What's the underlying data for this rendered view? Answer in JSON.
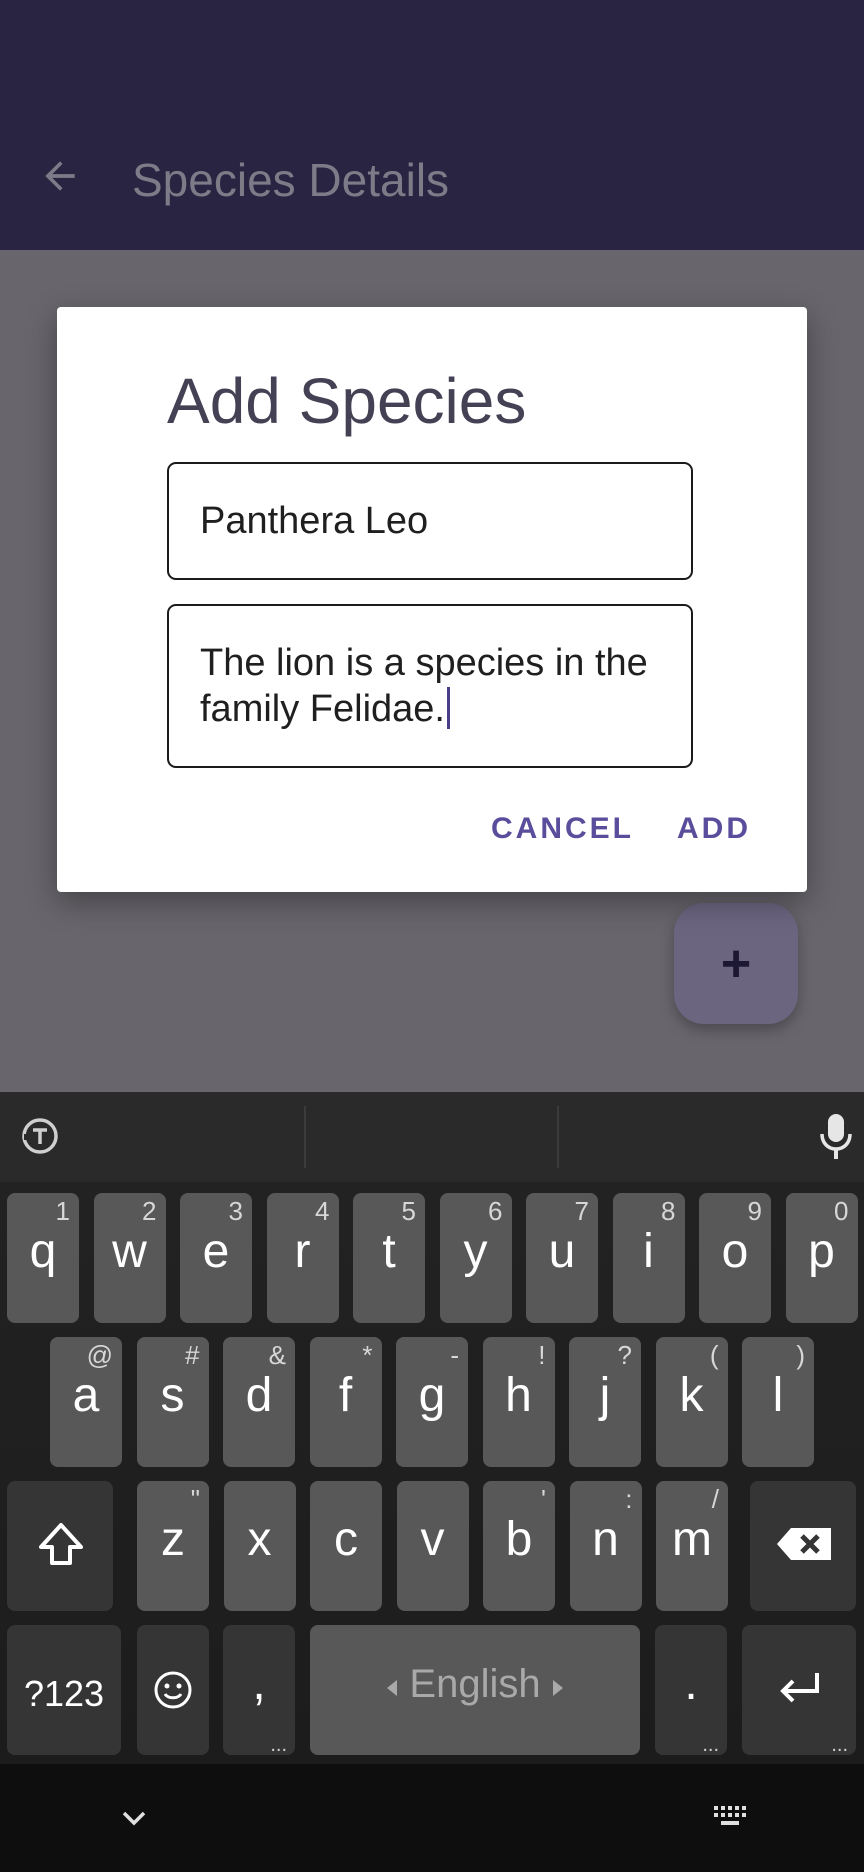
{
  "app_bar": {
    "title": "Species Details",
    "back_icon": "arrow-left-icon"
  },
  "fab": {
    "label": "+",
    "icon": "add-icon"
  },
  "dialog": {
    "title": "Add Species",
    "name_value": "Panthera Leo",
    "description_value": "The lion is a species in the family Felidae.",
    "cancel_label": "CANCEL",
    "add_label": "ADD",
    "accent_color": "#5a4d9c"
  },
  "keyboard": {
    "row1": [
      {
        "key": "q",
        "hint": "1"
      },
      {
        "key": "w",
        "hint": "2"
      },
      {
        "key": "e",
        "hint": "3"
      },
      {
        "key": "r",
        "hint": "4"
      },
      {
        "key": "t",
        "hint": "5"
      },
      {
        "key": "y",
        "hint": "6"
      },
      {
        "key": "u",
        "hint": "7"
      },
      {
        "key": "i",
        "hint": "8"
      },
      {
        "key": "o",
        "hint": "9"
      },
      {
        "key": "p",
        "hint": "0"
      }
    ],
    "row2": [
      {
        "key": "a",
        "hint": "@"
      },
      {
        "key": "s",
        "hint": "#"
      },
      {
        "key": "d",
        "hint": "&"
      },
      {
        "key": "f",
        "hint": "*"
      },
      {
        "key": "g",
        "hint": "-"
      },
      {
        "key": "h",
        "hint": "!"
      },
      {
        "key": "j",
        "hint": "?"
      },
      {
        "key": "k",
        "hint": "("
      },
      {
        "key": "l",
        "hint": ")"
      }
    ],
    "row3": [
      {
        "key": "z",
        "hint": "\""
      },
      {
        "key": "x",
        "hint": ""
      },
      {
        "key": "c",
        "hint": ""
      },
      {
        "key": "v",
        "hint": ""
      },
      {
        "key": "b",
        "hint": "'"
      },
      {
        "key": "n",
        "hint": ":"
      },
      {
        "key": "m",
        "hint": "/"
      }
    ],
    "symbols_label": "?123",
    "comma_label": ",",
    "space_label": "English",
    "period_label": ".",
    "icons": [
      "translate-icon",
      "microphone-icon",
      "shift-icon",
      "backspace-icon",
      "emoji-icon",
      "enter-icon",
      "chevron-down-icon",
      "keyboard-icon"
    ]
  }
}
